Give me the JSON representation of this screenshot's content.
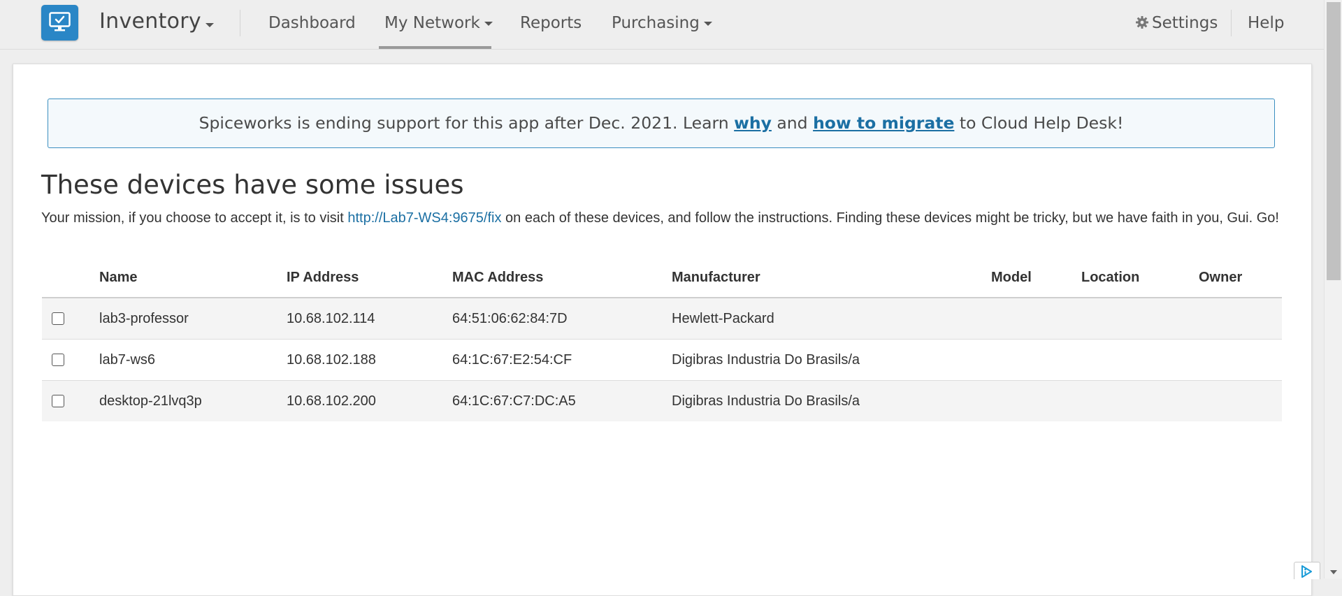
{
  "app": {
    "title": "Inventory"
  },
  "nav": {
    "items": [
      {
        "label": "Dashboard"
      },
      {
        "label": "My Network"
      },
      {
        "label": "Reports"
      },
      {
        "label": "Purchasing"
      }
    ],
    "settings_label": "Settings",
    "help_label": "Help",
    "active": "My Network"
  },
  "notice": {
    "text_before": "Spiceworks is ending support for this app after Dec. 2021. Learn ",
    "link_why": "why",
    "text_and": " and ",
    "link_migrate": "how to migrate",
    "text_after": " to Cloud Help Desk!"
  },
  "main": {
    "heading": "These devices have some issues",
    "description_before": "Your mission, if you choose to accept it, is to visit ",
    "description_link": "http://Lab7-WS4:9675/fix",
    "description_after": " on each of these devices, and follow the instructions. Finding these devices might be tricky, but we have faith in you, Gui. Go!"
  },
  "table": {
    "columns": [
      "Name",
      "IP Address",
      "MAC Address",
      "Manufacturer",
      "Model",
      "Location",
      "Owner"
    ],
    "rows": [
      {
        "checked": false,
        "name": "lab3-professor",
        "ip": "10.68.102.114",
        "mac": "64:51:06:62:84:7D",
        "manufacturer": "Hewlett-Packard",
        "model": "",
        "location": "",
        "owner": ""
      },
      {
        "checked": false,
        "name": "lab7-ws6",
        "ip": "10.68.102.188",
        "mac": "64:1C:67:E2:54:CF",
        "manufacturer": "Digibras Industria Do Brasils/a",
        "model": "",
        "location": "",
        "owner": ""
      },
      {
        "checked": false,
        "name": "desktop-21lvq3p",
        "ip": "10.68.102.200",
        "mac": "64:1C:67:C7:DC:A5",
        "manufacturer": "Digibras Industria Do Brasils/a",
        "model": "",
        "location": "",
        "owner": ""
      }
    ]
  },
  "colors": {
    "brand": "#2a86c6",
    "link": "#1b6fa3",
    "notice_border": "#3b8fc0",
    "row_stripe": "#f4f4f4"
  },
  "icons": {
    "logo": "monitor-check-icon",
    "settings": "gear-icon",
    "adchoices": "adchoices-icon"
  }
}
